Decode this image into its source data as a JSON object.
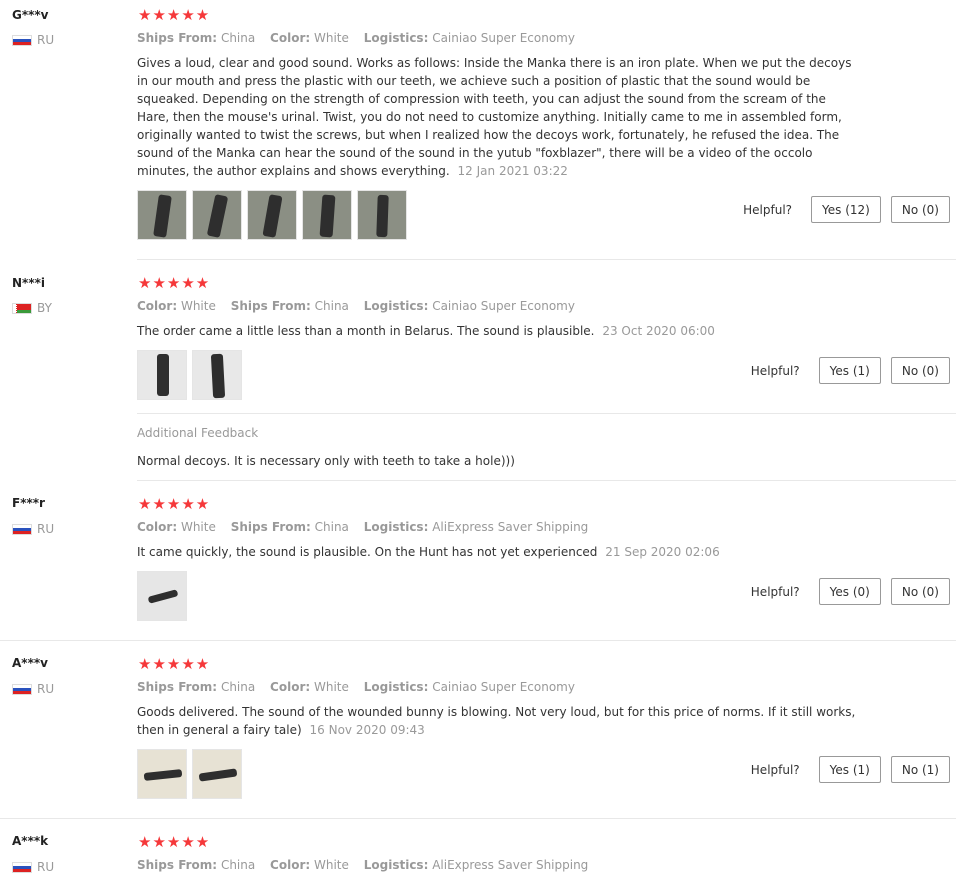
{
  "helpful_label": "Helpful?",
  "stars": "★★★★★",
  "reviews": [
    {
      "user": "G***v",
      "country": "RU",
      "meta": [
        {
          "k": "Ships From:",
          "v": "China"
        },
        {
          "k": "Color:",
          "v": "White"
        },
        {
          "k": "Logistics:",
          "v": "Cainiao Super Economy"
        }
      ],
      "text": "Gives a loud, clear and good sound. Works as follows: Inside the Manka there is an iron plate. When we put the decoys in our mouth and press the plastic with our teeth, we achieve such a position of plastic that the sound would be squeaked. Depending on the strength of compression with teeth, you can adjust the sound from the scream of the Hare, then the mouse's urinal. Twist, you do not need to customize anything. Initially came to me in assembled form, originally wanted to twist the screws, but when I realized how the decoys work, fortunately, he refused the idea. The sound of the Manka can hear the sound of the sound in the yutub \"foxblazer\", there will be a video of the occolo minutes, the author explains and shows everything.",
      "date": "12 Jan 2021 03:22",
      "yes": "Yes (12)",
      "no": "No (0)"
    },
    {
      "user": "N***i",
      "country": "BY",
      "meta": [
        {
          "k": "Color:",
          "v": "White"
        },
        {
          "k": "Ships From:",
          "v": "China"
        },
        {
          "k": "Logistics:",
          "v": "Cainiao Super Economy"
        }
      ],
      "text": "The order came a little less than a month in Belarus. The sound is plausible.",
      "date": "23 Oct 2020 06:00",
      "yes": "Yes (1)",
      "no": "No (0)",
      "additional_title": "Additional Feedback",
      "additional_text": "Normal decoys. It is necessary only with teeth to take a hole)))"
    },
    {
      "user": "F***r",
      "country": "RU",
      "meta": [
        {
          "k": "Color:",
          "v": "White"
        },
        {
          "k": "Ships From:",
          "v": "China"
        },
        {
          "k": "Logistics:",
          "v": "AliExpress Saver Shipping"
        }
      ],
      "text": "It came quickly, the sound is plausible. On the Hunt has not yet experienced",
      "date": "21 Sep 2020 02:06",
      "yes": "Yes (0)",
      "no": "No (0)"
    },
    {
      "user": "A***v",
      "country": "RU",
      "meta": [
        {
          "k": "Ships From:",
          "v": "China"
        },
        {
          "k": "Color:",
          "v": "White"
        },
        {
          "k": "Logistics:",
          "v": "Cainiao Super Economy"
        }
      ],
      "text": "Goods delivered. The sound of the wounded bunny is blowing. Not very loud, but for this price of norms. If it still works, then in general a fairy tale)",
      "date": "16 Nov 2020 09:43",
      "yes": "Yes (1)",
      "no": "No (1)"
    },
    {
      "user": "A***k",
      "country": "RU",
      "meta": [
        {
          "k": "Ships From:",
          "v": "China"
        },
        {
          "k": "Color:",
          "v": "White"
        },
        {
          "k": "Logistics:",
          "v": "AliExpress Saver Shipping"
        }
      ]
    }
  ]
}
